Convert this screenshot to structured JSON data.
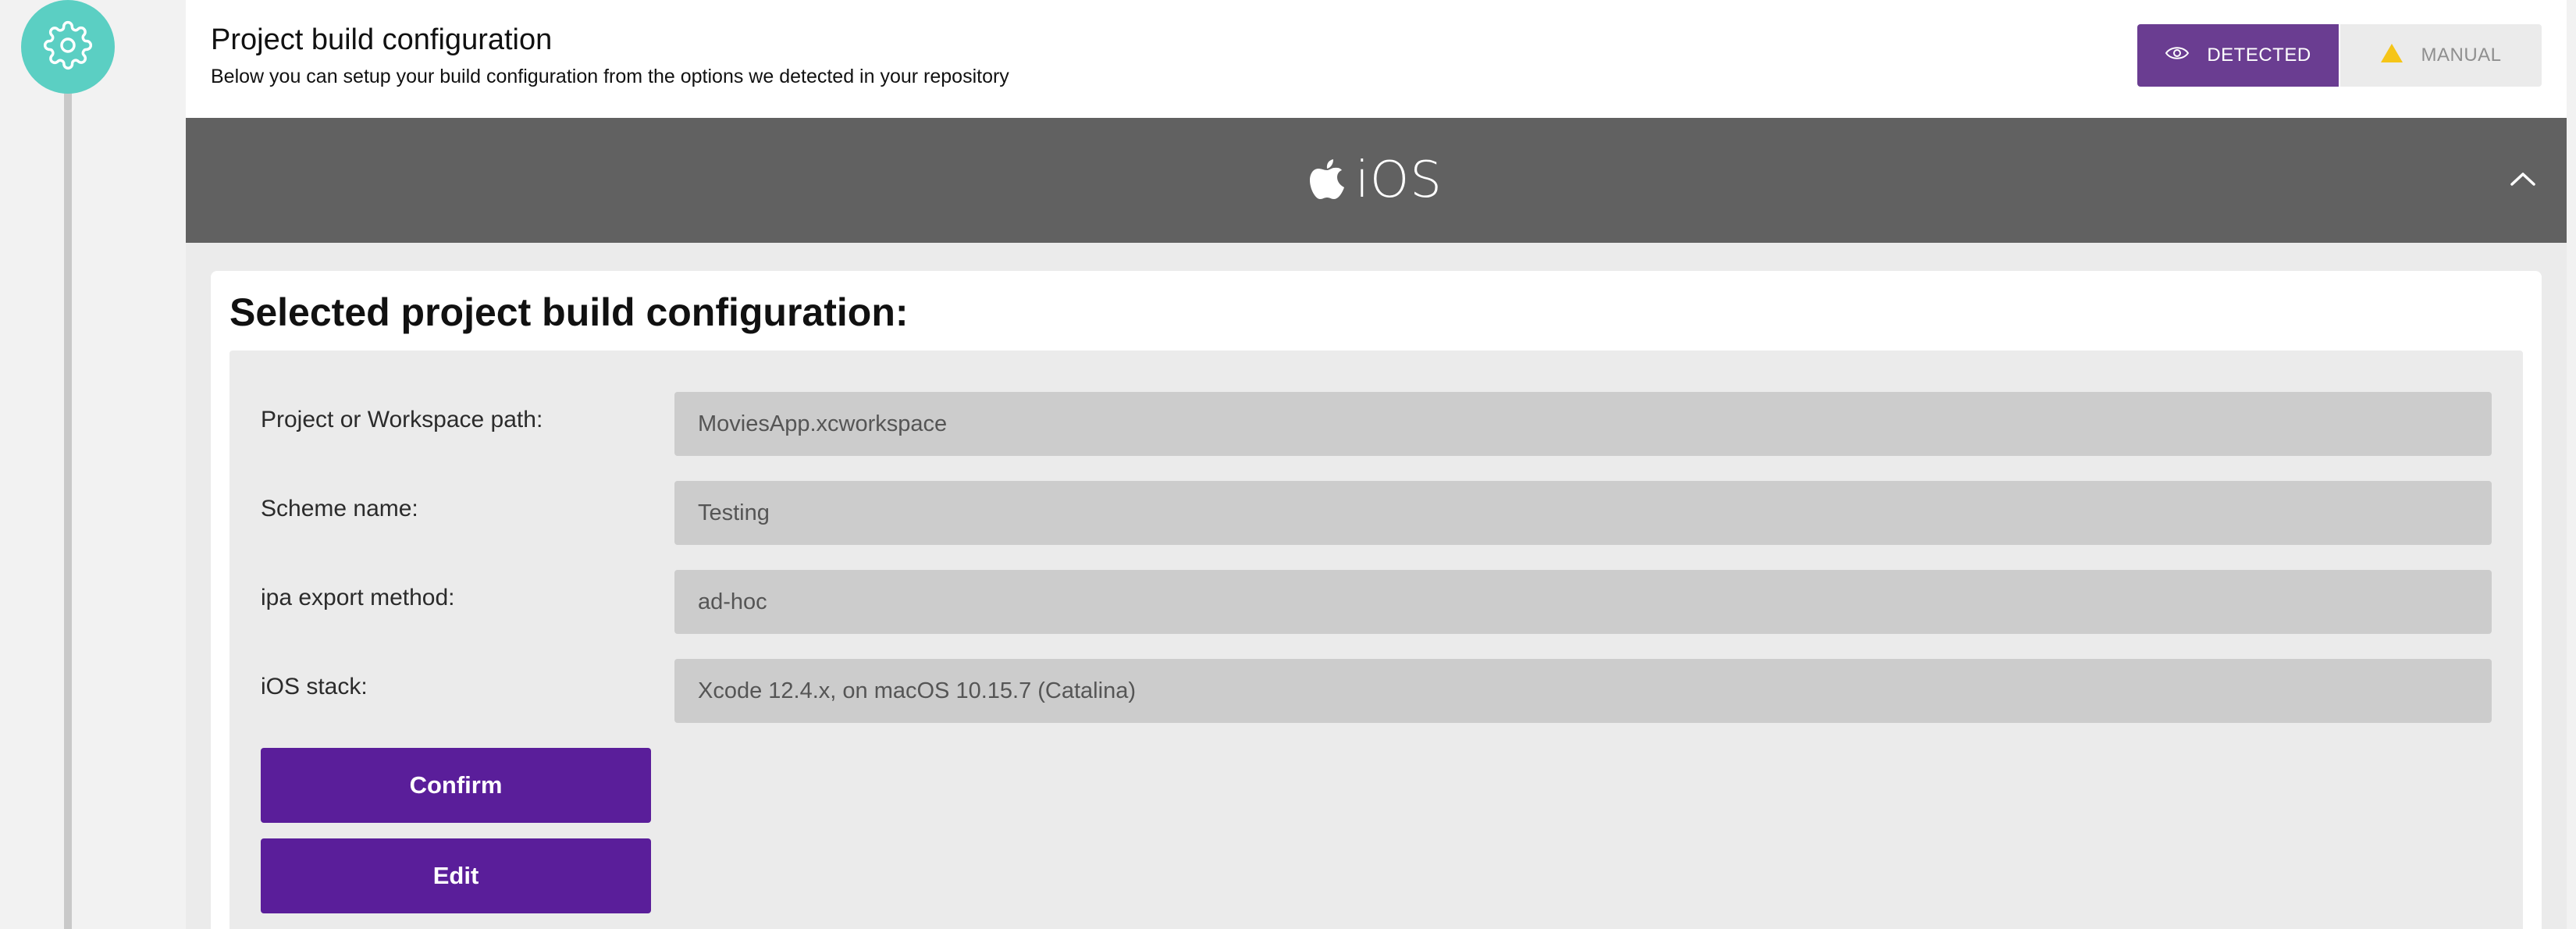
{
  "header": {
    "title": "Project build configuration",
    "subtitle": "Below you can setup your build configuration from the options we detected in your repository"
  },
  "mode_toggle": {
    "options": [
      {
        "label": "DETECTED",
        "icon": "eye-icon",
        "active": true
      },
      {
        "label": "MANUAL",
        "icon": "warning-triangle-icon",
        "active": false
      }
    ]
  },
  "platform": {
    "name": "iOS",
    "icon": "apple-icon"
  },
  "config": {
    "title": "Selected project build configuration:",
    "fields": [
      {
        "label": "Project or Workspace path:",
        "value": "MoviesApp.xcworkspace"
      },
      {
        "label": "Scheme name:",
        "value": "Testing"
      },
      {
        "label": "ipa export method:",
        "value": "ad-hoc"
      },
      {
        "label": "iOS stack:",
        "value": "Xcode 12.4.x, on macOS 10.15.7 (Catalina)"
      }
    ],
    "confirm_label": "Confirm",
    "edit_label": "Edit"
  },
  "colors": {
    "step_circle": "#5bcfc3",
    "accent_purple": "#6a3d91",
    "button_purple": "#5a1e9a",
    "platform_bar": "#616161",
    "warning_yellow": "#f5c518"
  }
}
